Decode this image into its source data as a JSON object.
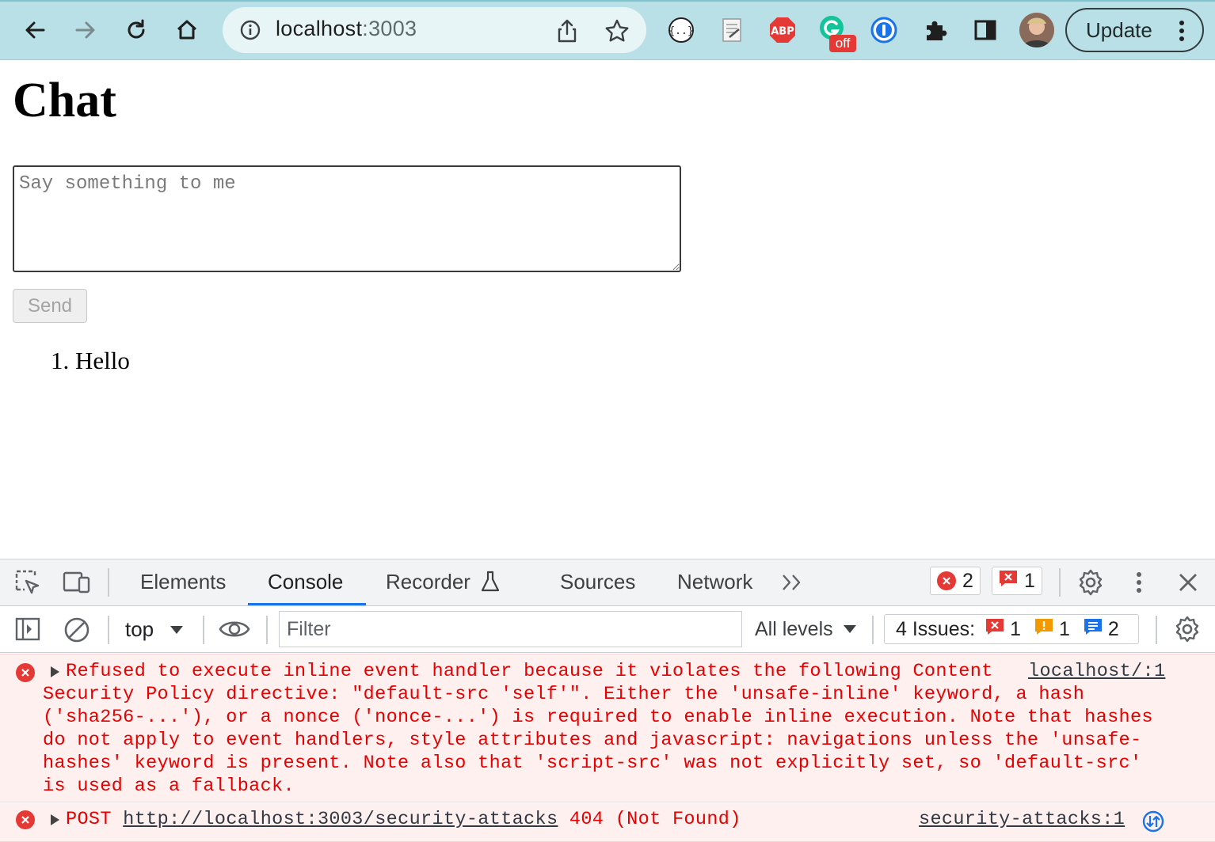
{
  "browser": {
    "url_host": "localhost",
    "url_port": ":3003",
    "update_label": "Update",
    "extensions": [
      {
        "name": "json-formatter-icon"
      },
      {
        "name": "notes-extension-icon"
      },
      {
        "name": "adblock-plus-icon",
        "label": "ABP"
      },
      {
        "name": "grammarly-icon",
        "badge": "off"
      },
      {
        "name": "1password-icon"
      },
      {
        "name": "puzzle-extensions-icon"
      }
    ]
  },
  "page": {
    "title": "Chat",
    "textarea_placeholder": "Say something to me",
    "send_label": "Send",
    "messages": [
      {
        "number": "1.",
        "text": "Hello"
      }
    ]
  },
  "devtools": {
    "tabs": [
      "Elements",
      "Console",
      "Recorder",
      "Sources",
      "Network"
    ],
    "error_count": "2",
    "issue_count_badge": "1",
    "context": "top",
    "filter_placeholder": "Filter",
    "levels": "All levels",
    "issues_label": "4 Issues:",
    "issues_breakdown": {
      "errors": "1",
      "warnings": "1",
      "info": "2"
    },
    "colors": {
      "accent": "#1a73e8",
      "error": "#e60000",
      "error_bg": "#fff0f0"
    },
    "messages": [
      {
        "lines": [
          "Refused to execute inline event handler because it violates the following Content",
          "Security Policy directive: \"default-src 'self'\". Either the 'unsafe-inline' keyword, a hash",
          "('sha256-...'), or a nonce ('nonce-...') is required to enable inline execution. Note that hashes",
          "do not apply to event handlers, style attributes and javascript: navigations unless the 'unsafe-",
          "hashes' keyword is present. Note also that 'script-src' was not explicitly set, so 'default-src'",
          "is used as a fallback."
        ],
        "source": "localhost/:1"
      },
      {
        "method": "POST",
        "url": "http://localhost:3003/security-attacks",
        "status": "404 (Not Found)",
        "source": "security-attacks:1"
      }
    ]
  }
}
